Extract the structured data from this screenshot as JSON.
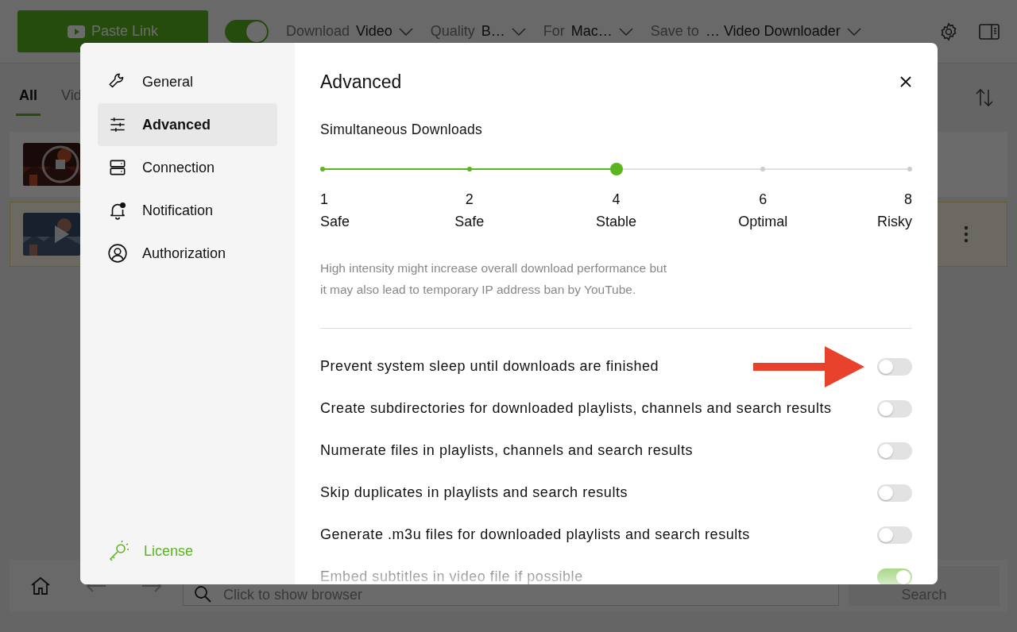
{
  "toolbar": {
    "paste_button": "Paste Link",
    "mode_toggle": {
      "on": true
    },
    "selectors": [
      {
        "label": "Download",
        "value": "Video"
      },
      {
        "label": "Quality",
        "value": "B…"
      },
      {
        "label": "For",
        "value": "Mac…"
      },
      {
        "label": "Save to",
        "value": "… Video Downloader"
      }
    ]
  },
  "tabs": [
    {
      "label": "All",
      "selected": true
    },
    {
      "label": "Vid",
      "selected": false
    }
  ],
  "downloads": [
    {
      "kind": "stop",
      "selected": false
    },
    {
      "kind": "play",
      "selected": true
    }
  ],
  "browser_bar": {
    "placeholder": "Click to show browser",
    "button": "Search"
  },
  "dialog": {
    "nav": [
      {
        "label": "General",
        "selected": false
      },
      {
        "label": "Advanced",
        "selected": true
      },
      {
        "label": "Connection",
        "selected": false
      },
      {
        "label": "Notification",
        "selected": false
      },
      {
        "label": "Authorization",
        "selected": false
      }
    ],
    "license": "License",
    "title": "Advanced",
    "section": "Simultaneous Downloads",
    "slider": {
      "stops": [
        {
          "value": "1",
          "label": "Safe",
          "selected": false
        },
        {
          "value": "2",
          "label": "Safe",
          "selected": false
        },
        {
          "value": "4",
          "label": "Stable",
          "selected": true
        },
        {
          "value": "6",
          "label": "Optimal",
          "selected": false
        },
        {
          "value": "8",
          "label": "Risky",
          "selected": false
        }
      ]
    },
    "hint": "High intensity might increase overall download performance but it may also lead to temporary IP address ban by YouTube.",
    "options": [
      {
        "label": "Prevent system sleep until downloads are finished",
        "on": false
      },
      {
        "label": "Create subdirectories for downloaded playlists, channels and search results",
        "on": false
      },
      {
        "label": "Numerate files in playlists, channels and search results",
        "on": false
      },
      {
        "label": "Skip duplicates in playlists and search results",
        "on": false
      },
      {
        "label": "Generate .m3u files for downloaded playlists and search results",
        "on": false
      },
      {
        "label": "Embed subtitles in video file if possible",
        "on": true
      }
    ]
  }
}
